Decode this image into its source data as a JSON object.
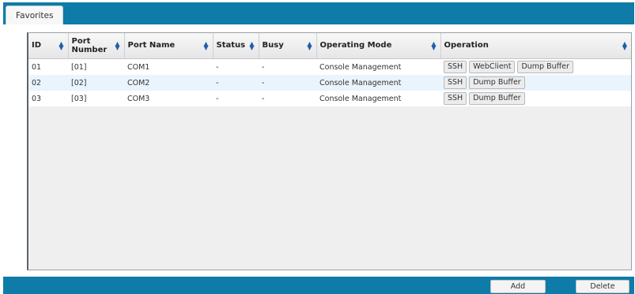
{
  "tabs": [
    {
      "label": "Favorites"
    }
  ],
  "table": {
    "columns": [
      {
        "label": "ID",
        "sortable": true
      },
      {
        "label": "Port Number",
        "sortable": true
      },
      {
        "label": "Port Name",
        "sortable": true
      },
      {
        "label": "Status",
        "sortable": true
      },
      {
        "label": "Busy",
        "sortable": true
      },
      {
        "label": "Operating Mode",
        "sortable": true
      },
      {
        "label": "Operation",
        "sortable": true
      }
    ],
    "rows": [
      {
        "id": "01",
        "port_number": "[01]",
        "port_name": "COM1",
        "status": "-",
        "busy": "-",
        "mode": "Console Management",
        "operations": [
          "SSH",
          "WebClient",
          "Dump Buffer"
        ]
      },
      {
        "id": "02",
        "port_number": "[02]",
        "port_name": "COM2",
        "status": "-",
        "busy": "-",
        "mode": "Console Management",
        "operations": [
          "SSH",
          "Dump Buffer"
        ]
      },
      {
        "id": "03",
        "port_number": "[03]",
        "port_name": "COM3",
        "status": "-",
        "busy": "-",
        "mode": "Console Management",
        "operations": [
          "SSH",
          "Dump Buffer"
        ]
      }
    ]
  },
  "footer": {
    "add_label": "Add",
    "delete_label": "Delete"
  },
  "colors": {
    "accent": "#0e7ba8",
    "header_bg": "#e6e6e6",
    "alt_row": "#eaf4fc",
    "sort_icon": "#1f5fa8"
  }
}
